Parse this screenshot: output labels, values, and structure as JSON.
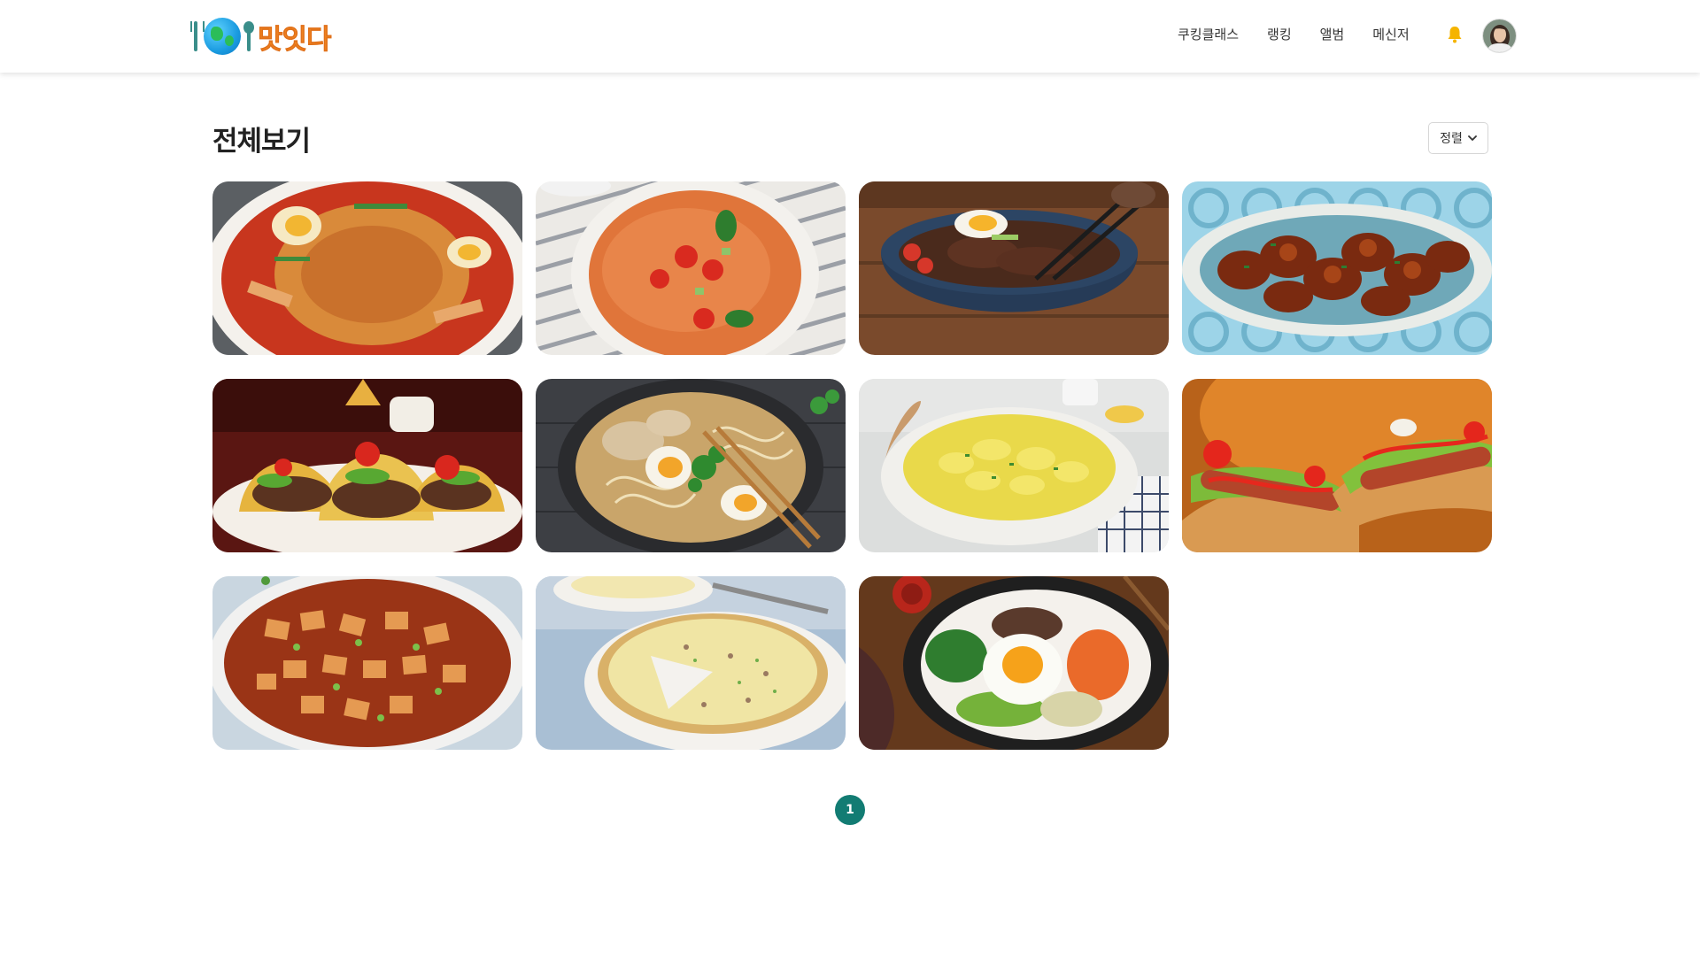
{
  "header": {
    "logo_text": "맛잇다",
    "nav": [
      {
        "label": "쿠킹클래스"
      },
      {
        "label": "랭킹"
      },
      {
        "label": "앨범"
      },
      {
        "label": "메신저"
      }
    ]
  },
  "page": {
    "title": "전체보기",
    "sort_label": "정렬"
  },
  "recipes": [
    {
      "image": "spicy-ramen-tteokbokki-dish"
    },
    {
      "image": "tomato-soup-bowl"
    },
    {
      "image": "beef-rice-bowl-with-egg"
    },
    {
      "image": "glazed-chicken-platter"
    },
    {
      "image": "beef-tacos-plate"
    },
    {
      "image": "chicken-ramen-bowl"
    },
    {
      "image": "potato-salad-bowl"
    },
    {
      "image": "hot-dogs"
    },
    {
      "image": "mapo-tofu"
    },
    {
      "image": "quiche"
    },
    {
      "image": "bibimbap"
    }
  ],
  "pagination": {
    "current": "1"
  },
  "colors": {
    "accent": "#127c73",
    "logo": "#f58a1f",
    "bell": "#f5b400"
  }
}
